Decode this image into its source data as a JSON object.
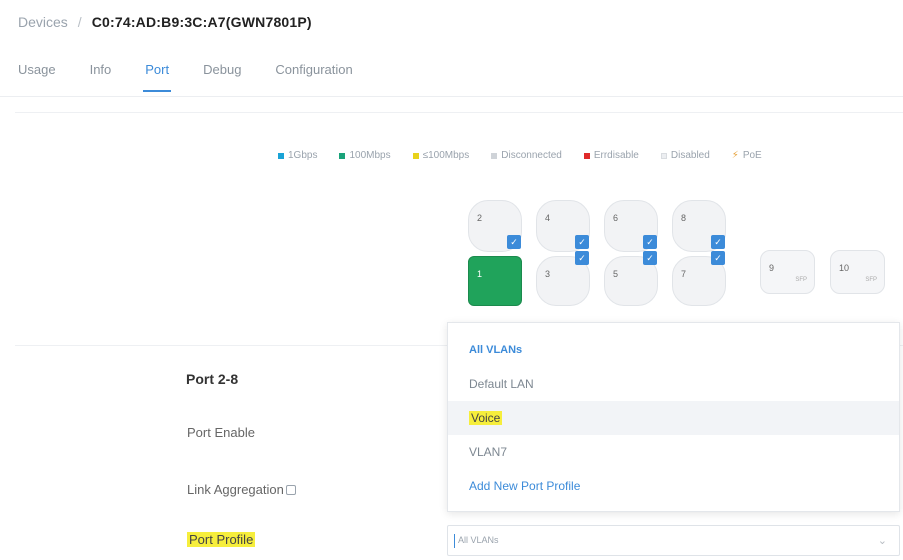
{
  "breadcrumb": {
    "parent": "Devices",
    "separator": "/",
    "current": "C0:74:AD:B9:3C:A7(GWN7801P)"
  },
  "tabs": [
    {
      "label": "Usage",
      "active": false
    },
    {
      "label": "Info",
      "active": false
    },
    {
      "label": "Port",
      "active": true
    },
    {
      "label": "Debug",
      "active": false
    },
    {
      "label": "Configuration",
      "active": false
    }
  ],
  "legend": [
    {
      "label": "1Gbps",
      "color": "#1aa3d6"
    },
    {
      "label": "100Mbps",
      "color": "#1aa37a"
    },
    {
      "label": "≤100Mbps",
      "color": "#e8d21b"
    },
    {
      "label": "Disconnected",
      "color": "#cfd3d8"
    },
    {
      "label": "Errdisable",
      "color": "#e02a2a"
    },
    {
      "label": "Disabled",
      "color": "#eceef1"
    },
    {
      "label": "PoE",
      "color": "#e6a23c"
    }
  ],
  "ports": {
    "top": [
      "2",
      "4",
      "6",
      "8"
    ],
    "bottom": [
      "1",
      "3",
      "5",
      "7"
    ],
    "sfp": [
      {
        "num": "9",
        "sub": "SFP"
      },
      {
        "num": "10",
        "sub": "SFP"
      }
    ]
  },
  "section": {
    "title": "Port 2-8"
  },
  "form": {
    "port_enable": "Port Enable",
    "link_aggregation": "Link Aggregation",
    "port_profile": "Port Profile"
  },
  "dropdown": {
    "items": [
      "All VLANs",
      "Default LAN",
      "Voice",
      "VLAN7",
      "Add New Port Profile"
    ]
  },
  "select": {
    "value": "All VLANs",
    "chevron": "⌄"
  }
}
